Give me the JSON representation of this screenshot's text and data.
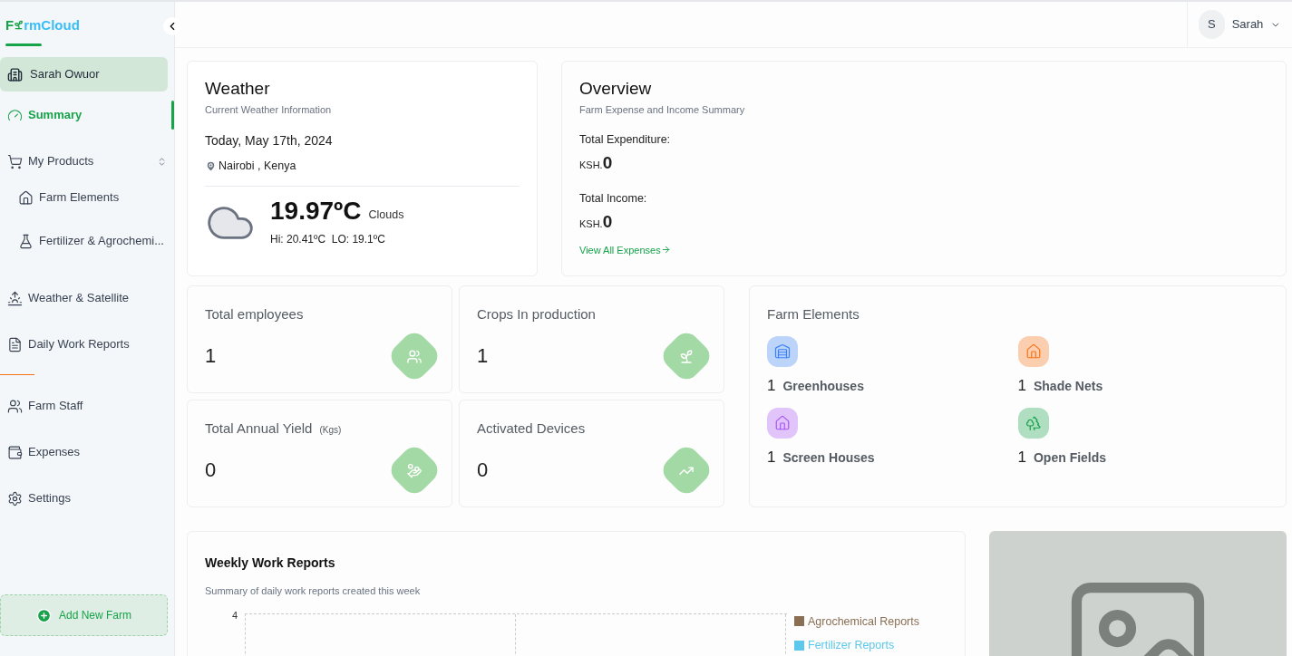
{
  "sidebar": {
    "logo": {
      "first": "F",
      "second": "rmCloud"
    },
    "farm": {
      "name": "Sarah Owuor"
    },
    "items": [
      {
        "label": "Summary",
        "selected": true
      },
      {
        "label": "My Products",
        "selected": false,
        "expanded": true,
        "children": [
          {
            "label": "Farm Elements",
            "selected": false
          },
          {
            "label": "Fertilizer & Agrochemi...",
            "selected": false
          }
        ]
      },
      {
        "label": "Weather & Satellite",
        "selected": false
      },
      {
        "label": "Daily Work Reports",
        "selected": false
      },
      {
        "label": "Farm Staff",
        "selected": false
      },
      {
        "label": "Expenses",
        "selected": false
      },
      {
        "label": "Settings",
        "selected": false
      }
    ],
    "add_button": "Add New Farm"
  },
  "user_menu": {
    "initial": "S",
    "name": "Sarah"
  },
  "weather": {
    "title": "Weather",
    "subtitle": "Current Weather Information",
    "date": "Today, May 17th, 2024",
    "location": "Nairobi , Kenya",
    "temperature": "19.97ºC",
    "condition": "Clouds",
    "hi_lo": "Hi: 20.41ºC  LO: 19.1ºC"
  },
  "overview": {
    "title": "Overview",
    "subtitle": "Farm Expense and Income Summary",
    "totals": [
      {
        "label": "Total Expenditure:",
        "currency": "KSH.",
        "amount": "0"
      },
      {
        "label": "Total Income:",
        "currency": "KSH.",
        "amount": "0"
      }
    ],
    "link": "View All Expenses"
  },
  "stats": [
    {
      "label": "Total employees",
      "value": "1"
    },
    {
      "label": "Crops In production",
      "value": "1"
    },
    {
      "label": "Total Annual Yield",
      "unit": "(Kgs)",
      "value": "0"
    },
    {
      "label": "Activated Devices",
      "value": "0"
    }
  ],
  "farm_elements": {
    "title": "Farm Elements",
    "items": [
      {
        "count": "1",
        "label": "Greenhouses",
        "color": "#3b82f6"
      },
      {
        "count": "1",
        "label": "Shade Nets",
        "color": "#f97316"
      },
      {
        "count": "1",
        "label": "Screen Houses",
        "color": "#a855f7"
      },
      {
        "count": "1",
        "label": "Open Fields",
        "color": "#16a34a"
      }
    ]
  },
  "weekly_reports": {
    "title": "Weekly Work Reports",
    "subtitle": "Summary of daily work reports created this week",
    "y_tick": "4",
    "legend": [
      {
        "label": "Agrochemical Reports",
        "color": "#8b6f55"
      },
      {
        "label": "Fertilizer Reports",
        "color": "#5bc8ec"
      }
    ]
  }
}
